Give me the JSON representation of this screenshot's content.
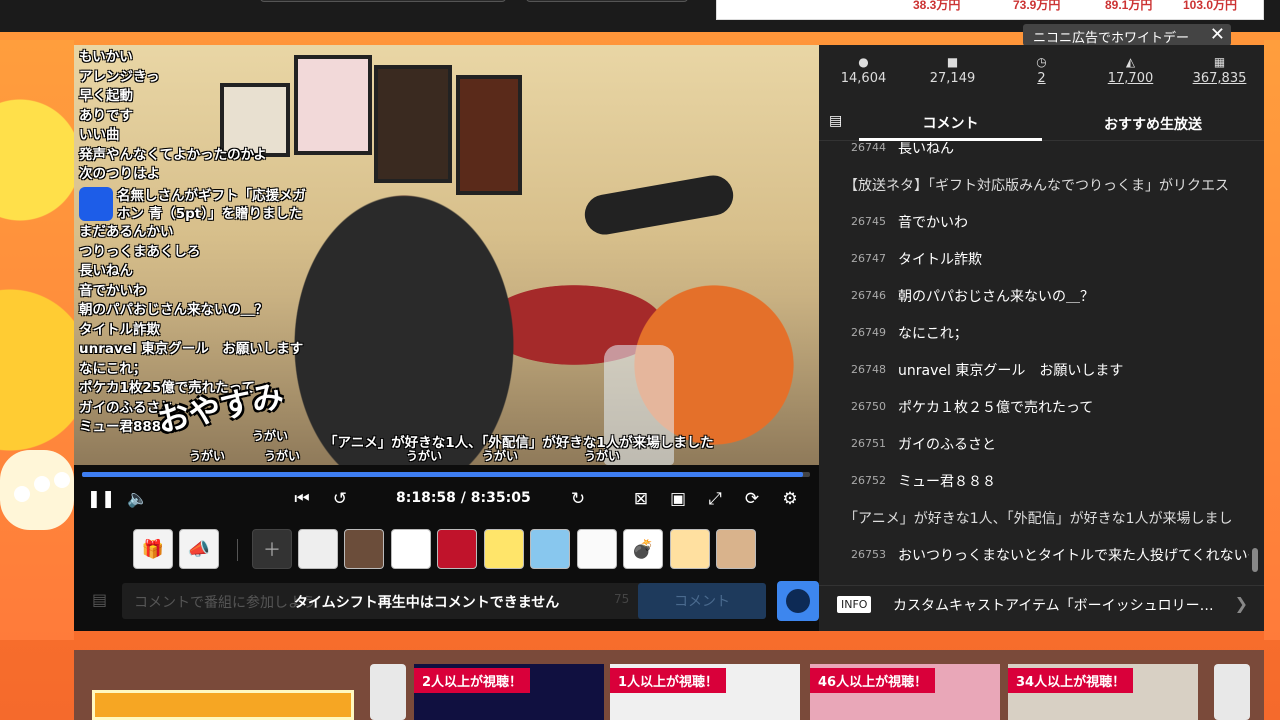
{
  "ad": {
    "prices": [
      "38.3万円",
      "73.9万円",
      "89.1万円",
      "103.0万円"
    ],
    "tag_label": "ニコニ広告でホワイトデー"
  },
  "player": {
    "overlay_comments": [
      "もいかい",
      "アレンジきっ",
      "早く起動",
      "ありです",
      "いい曲",
      "発声やんなくてよかったのかよ",
      "次のつりはよ"
    ],
    "gift_overlay": "名無しさんがギフト「応援メガホン 青（5pt）」を贈りました",
    "overlay_comments_2": [
      "まだあるんかい",
      "つりっくまあくしろ",
      "長いねん",
      "音でかいわ",
      "朝のパパおじさん来ないの＿？",
      "タイトル詐欺",
      "unravel 東京グール　お願いします",
      "なにこれ；",
      "ポケカ1枚25億で売れたって",
      "ガイのふるさと",
      "ミュー君888"
    ],
    "big_comment": "おやすみ",
    "banner": "「アニメ」が好きな1人、「外配信」が好きな1人が来場しました",
    "ugai": "うがい",
    "progress": 0.99,
    "time_current": "8:18:58",
    "time_total": "8:35:05",
    "icons": {
      "pause": "pause-icon",
      "volume": "volume-icon",
      "skip_back": "skip-back-icon",
      "rewind10": "rewind-10-icon",
      "forward10": "forward-10-icon",
      "comment_off": "comment-off-icon",
      "theater": "theater-icon",
      "fullscreen": "fullscreen-icon",
      "reload": "reload-icon",
      "settings": "gear-icon"
    }
  },
  "comment_bar": {
    "placeholder": "コメントで番組に参加しよう",
    "notice": "タイムシフト再生中はコメントできません",
    "count": "75",
    "submit": "コメント"
  },
  "gift_items": [
    {
      "name": "gift-icon",
      "glyph": "🎁"
    },
    {
      "name": "megaphone-icon",
      "glyph": "📣"
    }
  ],
  "stats": [
    {
      "icon": "user-icon",
      "glyph": "👤",
      "value": "14,604",
      "link": false
    },
    {
      "icon": "comment-icon",
      "glyph": "▬",
      "value": "27,149",
      "link": false
    },
    {
      "icon": "clock-icon",
      "glyph": "●",
      "value": "2",
      "link": true
    },
    {
      "icon": "megaphone-icon",
      "glyph": "📣",
      "value": "17,700",
      "link": true
    },
    {
      "icon": "gift-icon",
      "glyph": "🎁",
      "value": "367,835",
      "link": true
    }
  ],
  "tabs": {
    "comments": "コメント",
    "recommended": "おすすめ生放送"
  },
  "comments": [
    {
      "no": "26744",
      "text": "長いねん",
      "sys": false
    },
    {
      "no": "",
      "text": "【放送ネタ】「ギフト対応版みんなでつりっくま」がリクエス",
      "sys": true
    },
    {
      "no": "26745",
      "text": "音でかいわ",
      "sys": false
    },
    {
      "no": "26747",
      "text": "タイトル詐欺",
      "sys": false
    },
    {
      "no": "26746",
      "text": "朝のパパおじさん来ないの＿？",
      "sys": false
    },
    {
      "no": "26749",
      "text": "なにこれ；",
      "sys": false
    },
    {
      "no": "26748",
      "text": "unravel 東京グール　お願いします",
      "sys": false
    },
    {
      "no": "26750",
      "text": "ポケカ１枚２５億で売れたって",
      "sys": false
    },
    {
      "no": "26751",
      "text": "ガイのふるさと",
      "sys": false
    },
    {
      "no": "26752",
      "text": "ミュー君８８８",
      "sys": false
    },
    {
      "no": "",
      "text": "「アニメ」が好きな1人、「外配信」が好きな1人が来場しまし",
      "sys": true
    },
    {
      "no": "26753",
      "text": "おいつりっくまないとタイトルで来た人投げてくれないぞ",
      "sys": false
    }
  ],
  "info": {
    "badge": "INFO",
    "text": "カスタムキャストアイテム「ボーイッシュロリー…"
  },
  "recommendations": [
    {
      "badge": "2人以上が視聴！"
    },
    {
      "badge": "1人以上が視聴！"
    },
    {
      "badge": "46人以上が視聴！"
    },
    {
      "badge": "34人以上が視聴！"
    }
  ],
  "colors": {
    "accent": "#3e7ef2",
    "badge": "#d9003a",
    "panel": "#222222"
  }
}
